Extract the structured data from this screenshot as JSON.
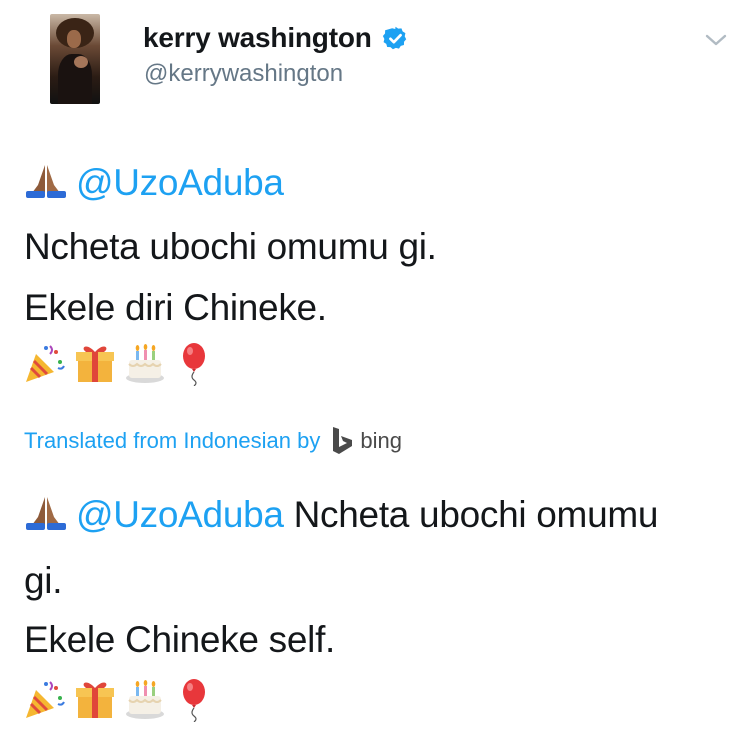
{
  "user": {
    "display_name": "kerry washington",
    "handle": "@kerrywashington",
    "verified": true
  },
  "tweet": {
    "mention": "@UzoAduba",
    "line1": "Ncheta ubochi omumu gi.",
    "line2": "Ekele diri Chineke.",
    "emojis": [
      "party-popper-icon",
      "gift-icon",
      "birthday-cake-icon",
      "balloon-icon"
    ]
  },
  "translation": {
    "label": "Translated from Indonesian by",
    "provider": "bing",
    "mention": "@UzoAduba",
    "line1_rest": "Ncheta ubochi omumu",
    "line1_wrap": "gi.",
    "line2": "Ekele Chineke self."
  },
  "colors": {
    "link": "#1da1f2",
    "secondary_text": "#657786",
    "primary_text": "#14171a"
  }
}
